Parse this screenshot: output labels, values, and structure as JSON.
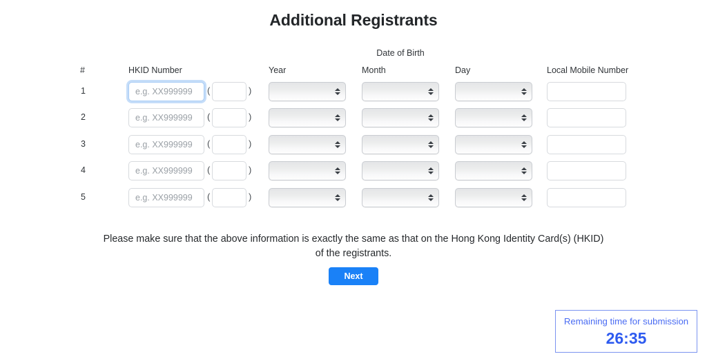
{
  "page": {
    "title": "Additional Registrants"
  },
  "form": {
    "dob_group_label": "Date of Birth",
    "headers": {
      "number": "#",
      "hkid": "HKID Number",
      "year": "Year",
      "month": "Month",
      "day": "Day",
      "mobile": "Local Mobile Number"
    },
    "paren_open": "(",
    "paren_close": ")",
    "hkid_placeholder": "e.g. XX999999",
    "check_digit_placeholder": "",
    "mobile_placeholder": "",
    "select_placeholder": "",
    "rows": [
      {
        "index": "1",
        "hkid": "",
        "check_digit": "",
        "year": "",
        "month": "",
        "day": "",
        "mobile": "",
        "focused": true
      },
      {
        "index": "2",
        "hkid": "",
        "check_digit": "",
        "year": "",
        "month": "",
        "day": "",
        "mobile": "",
        "focused": false
      },
      {
        "index": "3",
        "hkid": "",
        "check_digit": "",
        "year": "",
        "month": "",
        "day": "",
        "mobile": "",
        "focused": false
      },
      {
        "index": "4",
        "hkid": "",
        "check_digit": "",
        "year": "",
        "month": "",
        "day": "",
        "mobile": "",
        "focused": false
      },
      {
        "index": "5",
        "hkid": "",
        "check_digit": "",
        "year": "",
        "month": "",
        "day": "",
        "mobile": "",
        "focused": false
      }
    ]
  },
  "notice": {
    "text": "Please make sure that the above information is exactly the same as that on the Hong Kong Identity Card(s) (HKID) of the registrants."
  },
  "actions": {
    "next_label": "Next"
  },
  "timer": {
    "label": "Remaining time for submission",
    "value": "26:35"
  },
  "colors": {
    "accent_blue": "#1a81f7",
    "timer_border": "#7b93f0",
    "timer_label": "#4a6cf3",
    "timer_value": "#2e5bf0",
    "focus_ring": "#a9cdf5",
    "input_border": "#d7dade",
    "text": "#2b2f33"
  }
}
